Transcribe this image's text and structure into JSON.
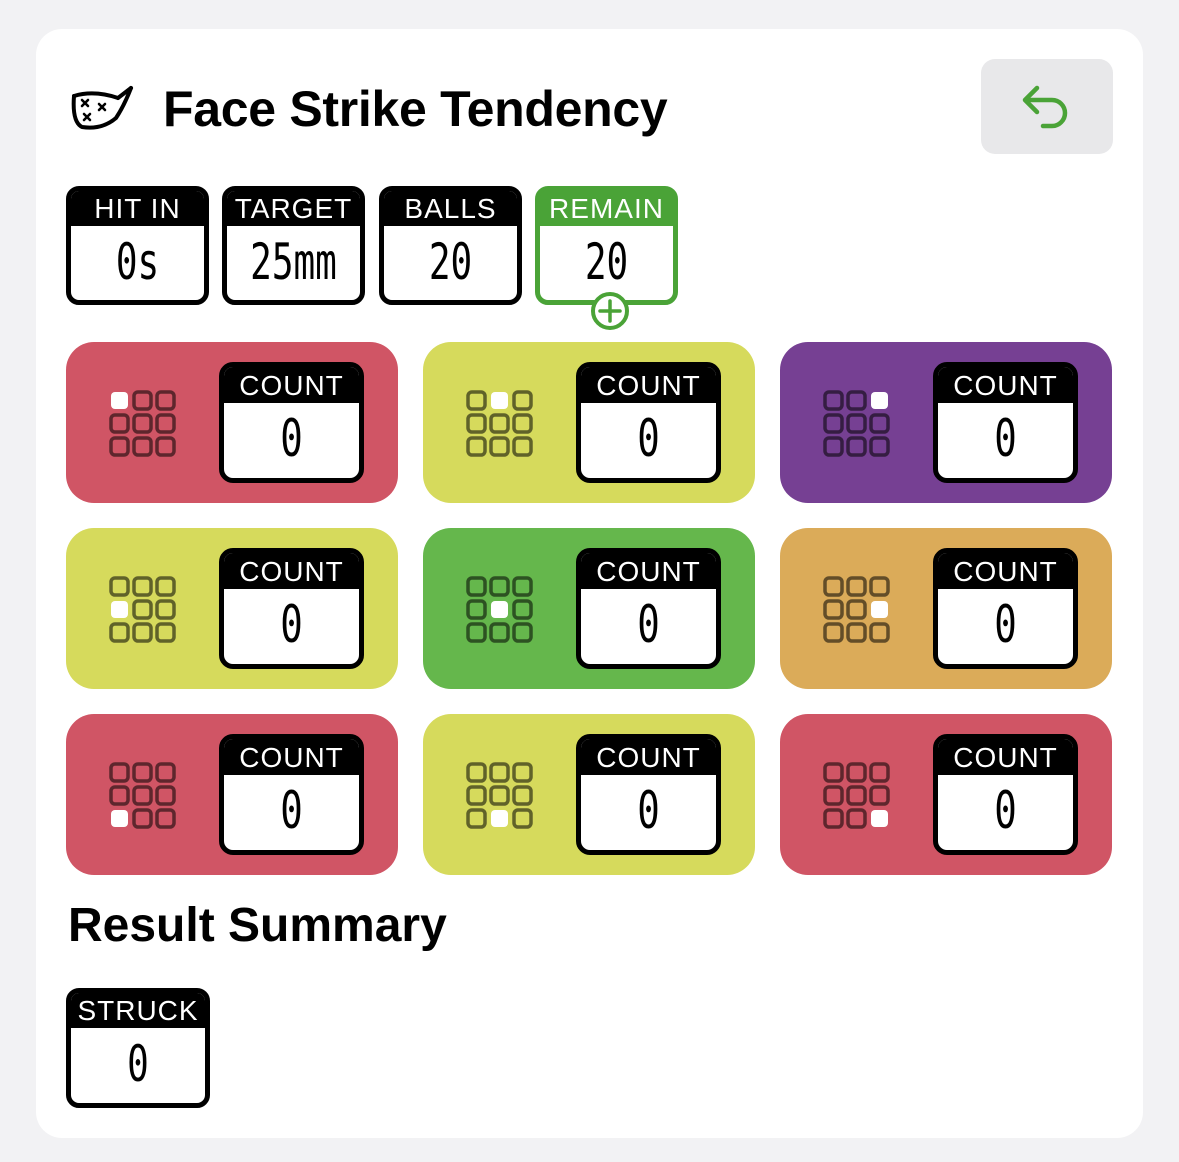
{
  "header": {
    "title": "Face Strike Tendency",
    "icon": "golf-club-face-icon",
    "back_icon": "undo-arrow-icon"
  },
  "stats": [
    {
      "label": "HIT IN",
      "value": "0s"
    },
    {
      "label": "TARGET",
      "value": "25mm"
    },
    {
      "label": "BALLS",
      "value": "20"
    },
    {
      "label": "REMAIN",
      "value": "20",
      "action_icon": "plus-circle-icon"
    }
  ],
  "zones": [
    {
      "name": "top-left",
      "color": "#d05565",
      "highlight": 0,
      "count_label": "COUNT",
      "count": "0"
    },
    {
      "name": "top-center",
      "color": "#d6da5c",
      "highlight": 1,
      "count_label": "COUNT",
      "count": "0"
    },
    {
      "name": "top-right",
      "color": "#764093",
      "highlight": 2,
      "count_label": "COUNT",
      "count": "0"
    },
    {
      "name": "middle-left",
      "color": "#d6da5c",
      "highlight": 3,
      "count_label": "COUNT",
      "count": "0"
    },
    {
      "name": "center",
      "color": "#65b74c",
      "highlight": 4,
      "count_label": "COUNT",
      "count": "0"
    },
    {
      "name": "middle-right",
      "color": "#dbab59",
      "highlight": 5,
      "count_label": "COUNT",
      "count": "0"
    },
    {
      "name": "bottom-left",
      "color": "#d05565",
      "highlight": 6,
      "count_label": "COUNT",
      "count": "0"
    },
    {
      "name": "bottom-center",
      "color": "#d6da5c",
      "highlight": 7,
      "count_label": "COUNT",
      "count": "0"
    },
    {
      "name": "bottom-right",
      "color": "#d05565",
      "highlight": 8,
      "count_label": "COUNT",
      "count": "0"
    }
  ],
  "summary": {
    "title": "Result Summary",
    "struck_label": "STRUCK",
    "struck_value": "0"
  },
  "colors": {
    "accent_green": "#4aa337",
    "back_button_bg": "#e8e8ea"
  }
}
